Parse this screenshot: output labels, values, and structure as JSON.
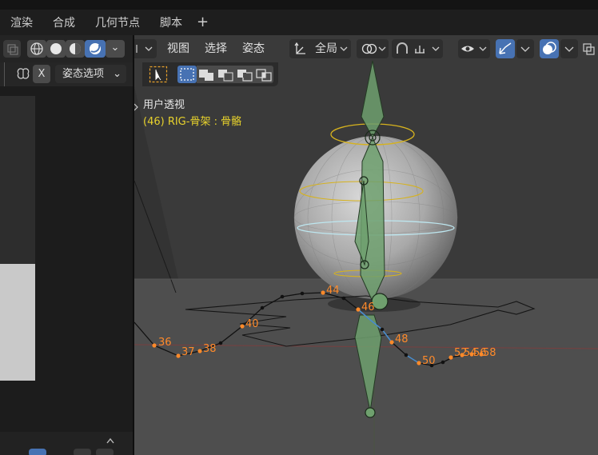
{
  "tabs": [
    "渲染",
    "合成",
    "几何节点",
    "脚本"
  ],
  "add_tab_symbol": "+",
  "left_panel": {
    "x_label": "X",
    "mode_select": "姿态选项",
    "dropdown_chevron": "⌄"
  },
  "viewport_menu": {
    "view": "视图",
    "select": "选择",
    "pose": "姿态",
    "transform_orientation": "全局"
  },
  "overlay": {
    "view_name": "用户透视",
    "object_info": "(46) RIG-骨架 : 骨骼"
  },
  "frame_labels": [
    "36",
    "37",
    "38",
    "40",
    "44",
    "46",
    "48",
    "50",
    "52",
    "54",
    "56",
    "58"
  ],
  "colors": {
    "accent": "#4772b3",
    "selected_frame": "#ff8a2a",
    "overlay_text": "#e8d22c"
  }
}
